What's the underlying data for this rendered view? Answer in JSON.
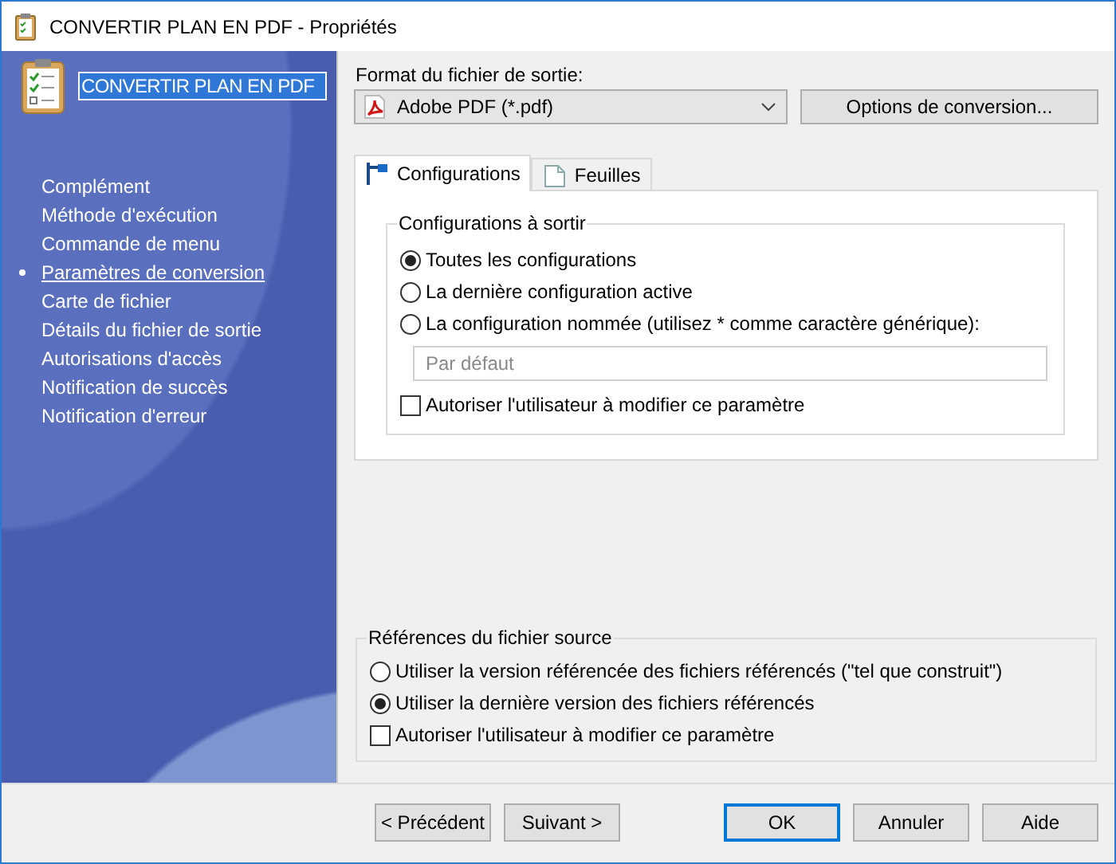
{
  "window": {
    "title": "CONVERTIR PLAN EN PDF - Propriétés"
  },
  "sidebar": {
    "heading": "CONVERTIR PLAN EN PDF",
    "items": [
      {
        "label": "Complément",
        "selected": false
      },
      {
        "label": "Méthode d'exécution",
        "selected": false
      },
      {
        "label": "Commande de menu",
        "selected": false
      },
      {
        "label": "Paramètres de conversion",
        "selected": true
      },
      {
        "label": "Carte de fichier",
        "selected": false
      },
      {
        "label": "Détails du fichier de sortie",
        "selected": false
      },
      {
        "label": "Autorisations d'accès",
        "selected": false
      },
      {
        "label": "Notification de succès",
        "selected": false
      },
      {
        "label": "Notification d'erreur",
        "selected": false
      }
    ]
  },
  "format": {
    "label": "Format du fichier de sortie:",
    "value": "Adobe PDF (*.pdf)",
    "button": "Options de conversion..."
  },
  "tabs": [
    {
      "label": "Configurations",
      "selected": true,
      "kind": "config"
    },
    {
      "label": "Feuilles",
      "selected": false,
      "kind": "sheet"
    }
  ],
  "configurations": {
    "title": "Configurations à sortir",
    "options": [
      {
        "label": "Toutes les configurations",
        "selected": true
      },
      {
        "label": "La dernière configuration active",
        "selected": false
      },
      {
        "label": "La configuration nommée (utilisez * comme caractère générique):",
        "selected": false
      }
    ],
    "name_field": {
      "placeholder": "Par défaut"
    },
    "allow": {
      "label": "Autoriser l'utilisateur à modifier ce paramètre",
      "checked": false
    }
  },
  "references": {
    "title": "Références du fichier source",
    "options": [
      {
        "label": "Utiliser la version référencée des fichiers référencés (\"tel que construit\")",
        "selected": false
      },
      {
        "label": "Utiliser la dernière version des fichiers référencés",
        "selected": true
      }
    ],
    "allow": {
      "label": "Autoriser l'utilisateur à modifier ce paramètre",
      "checked": false
    }
  },
  "buttons": [
    {
      "label": "< Précédent",
      "default": false,
      "kind": "nav"
    },
    {
      "label": "Suivant >",
      "default": false,
      "kind": "nav"
    },
    {
      "label": "OK",
      "default": true,
      "kind": "action"
    },
    {
      "label": "Annuler",
      "default": false,
      "kind": "action"
    },
    {
      "label": "Aide",
      "default": false,
      "kind": "action"
    }
  ]
}
